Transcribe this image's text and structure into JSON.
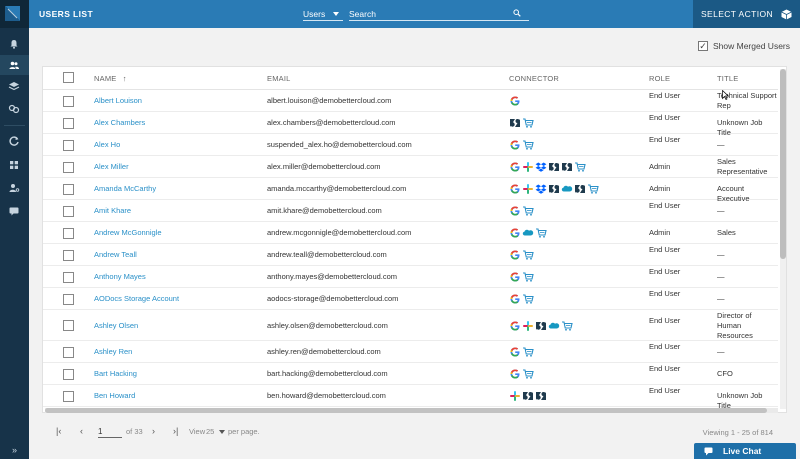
{
  "topbar": {
    "title": "USERS LIST",
    "filter_value": "Users",
    "search_placeholder": "Search",
    "select_action_label": "SELECT ACTION"
  },
  "sidebar": {
    "icons": [
      "bell-icon",
      "users-icon",
      "layers-icon",
      "link-icon",
      "refresh-icon",
      "grid-icon",
      "user-settings-icon",
      "chat-icon"
    ]
  },
  "options": {
    "show_merged_label": "Show Merged Users",
    "show_merged_checked": true,
    "check_mark": "✓"
  },
  "table": {
    "columns": {
      "name": "NAME",
      "email": "EMAIL",
      "connector": "CONNECTOR",
      "role": "ROLE",
      "title": "TITLE"
    },
    "sort_indicator": "↑",
    "rows": [
      {
        "name": "Albert Louison",
        "email": "albert.louison@demobettercloud.com",
        "connectors": [
          "google"
        ],
        "role": "End User",
        "title": "Technical Support Rep"
      },
      {
        "name": "Alex Chambers",
        "email": "alex.chambers@demobettercloud.com",
        "connectors": [
          "zendesk",
          "shopping"
        ],
        "role": "End User",
        "title": "Unknown Job Title"
      },
      {
        "name": "Alex Ho",
        "email": "suspended_alex.ho@demobettercloud.com",
        "connectors": [
          "google",
          "shopping"
        ],
        "role": "End User",
        "title": "—"
      },
      {
        "name": "Alex Miller",
        "email": "alex.miller@demobettercloud.com",
        "connectors": [
          "google",
          "slack",
          "dropbox",
          "zendesk",
          "zendesk",
          "shopping"
        ],
        "role": "Admin",
        "title": "Sales Representative"
      },
      {
        "name": "Amanda McCarthy",
        "email": "amanda.mccarthy@demobettercloud.com",
        "connectors": [
          "google",
          "slack",
          "dropbox",
          "zendesk",
          "salesforce",
          "zendesk",
          "shopping"
        ],
        "role": "Admin",
        "title": "Account Executive"
      },
      {
        "name": "Amit Khare",
        "email": "amit.khare@demobettercloud.com",
        "connectors": [
          "google",
          "shopping"
        ],
        "role": "End User",
        "title": "—"
      },
      {
        "name": "Andrew McGonnigle",
        "email": "andrew.mcgonnigle@demobettercloud.com",
        "connectors": [
          "google",
          "salesforce",
          "shopping"
        ],
        "role": "Admin",
        "title": "Sales"
      },
      {
        "name": "Andrew Teall",
        "email": "andrew.teall@demobettercloud.com",
        "connectors": [
          "google",
          "shopping"
        ],
        "role": "End User",
        "title": "—"
      },
      {
        "name": "Anthony Mayes",
        "email": "anthony.mayes@demobettercloud.com",
        "connectors": [
          "google",
          "shopping"
        ],
        "role": "End User",
        "title": "—"
      },
      {
        "name": "AODocs Storage Account",
        "email": "aodocs-storage@demobettercloud.com",
        "connectors": [
          "google",
          "shopping"
        ],
        "role": "End User",
        "title": "—"
      },
      {
        "name": "Ashley Olsen",
        "email": "ashley.olsen@demobettercloud.com",
        "connectors": [
          "google",
          "slack",
          "zendesk",
          "salesforce",
          "shopping"
        ],
        "role": "End User",
        "title": "Director of Human Resources"
      },
      {
        "name": "Ashley Ren",
        "email": "ashley.ren@demobettercloud.com",
        "connectors": [
          "google",
          "shopping"
        ],
        "role": "End User",
        "title": "—"
      },
      {
        "name": "Bart Hacking",
        "email": "bart.hacking@demobettercloud.com",
        "connectors": [
          "google",
          "shopping"
        ],
        "role": "End User",
        "title": "CFO"
      },
      {
        "name": "Ben Howard",
        "email": "ben.howard@demobettercloud.com",
        "connectors": [
          "slack",
          "zendesk",
          "zendesk"
        ],
        "role": "End User",
        "title": "Unknown Job Title"
      }
    ]
  },
  "pagination": {
    "first": "|‹",
    "prev": "‹",
    "page": "1",
    "of_label": "of 33",
    "next": "›",
    "last": "›|",
    "view_label": "View",
    "page_size": "25",
    "per_page_label": "per page.",
    "summary": "Viewing 1 - 25 of 814"
  },
  "live_chat": {
    "label": "Live Chat"
  },
  "colors": {
    "topbar": "#2a7bb5",
    "sidebar": "#173349",
    "link": "#2a90c8",
    "action_button": "#1b5985"
  }
}
